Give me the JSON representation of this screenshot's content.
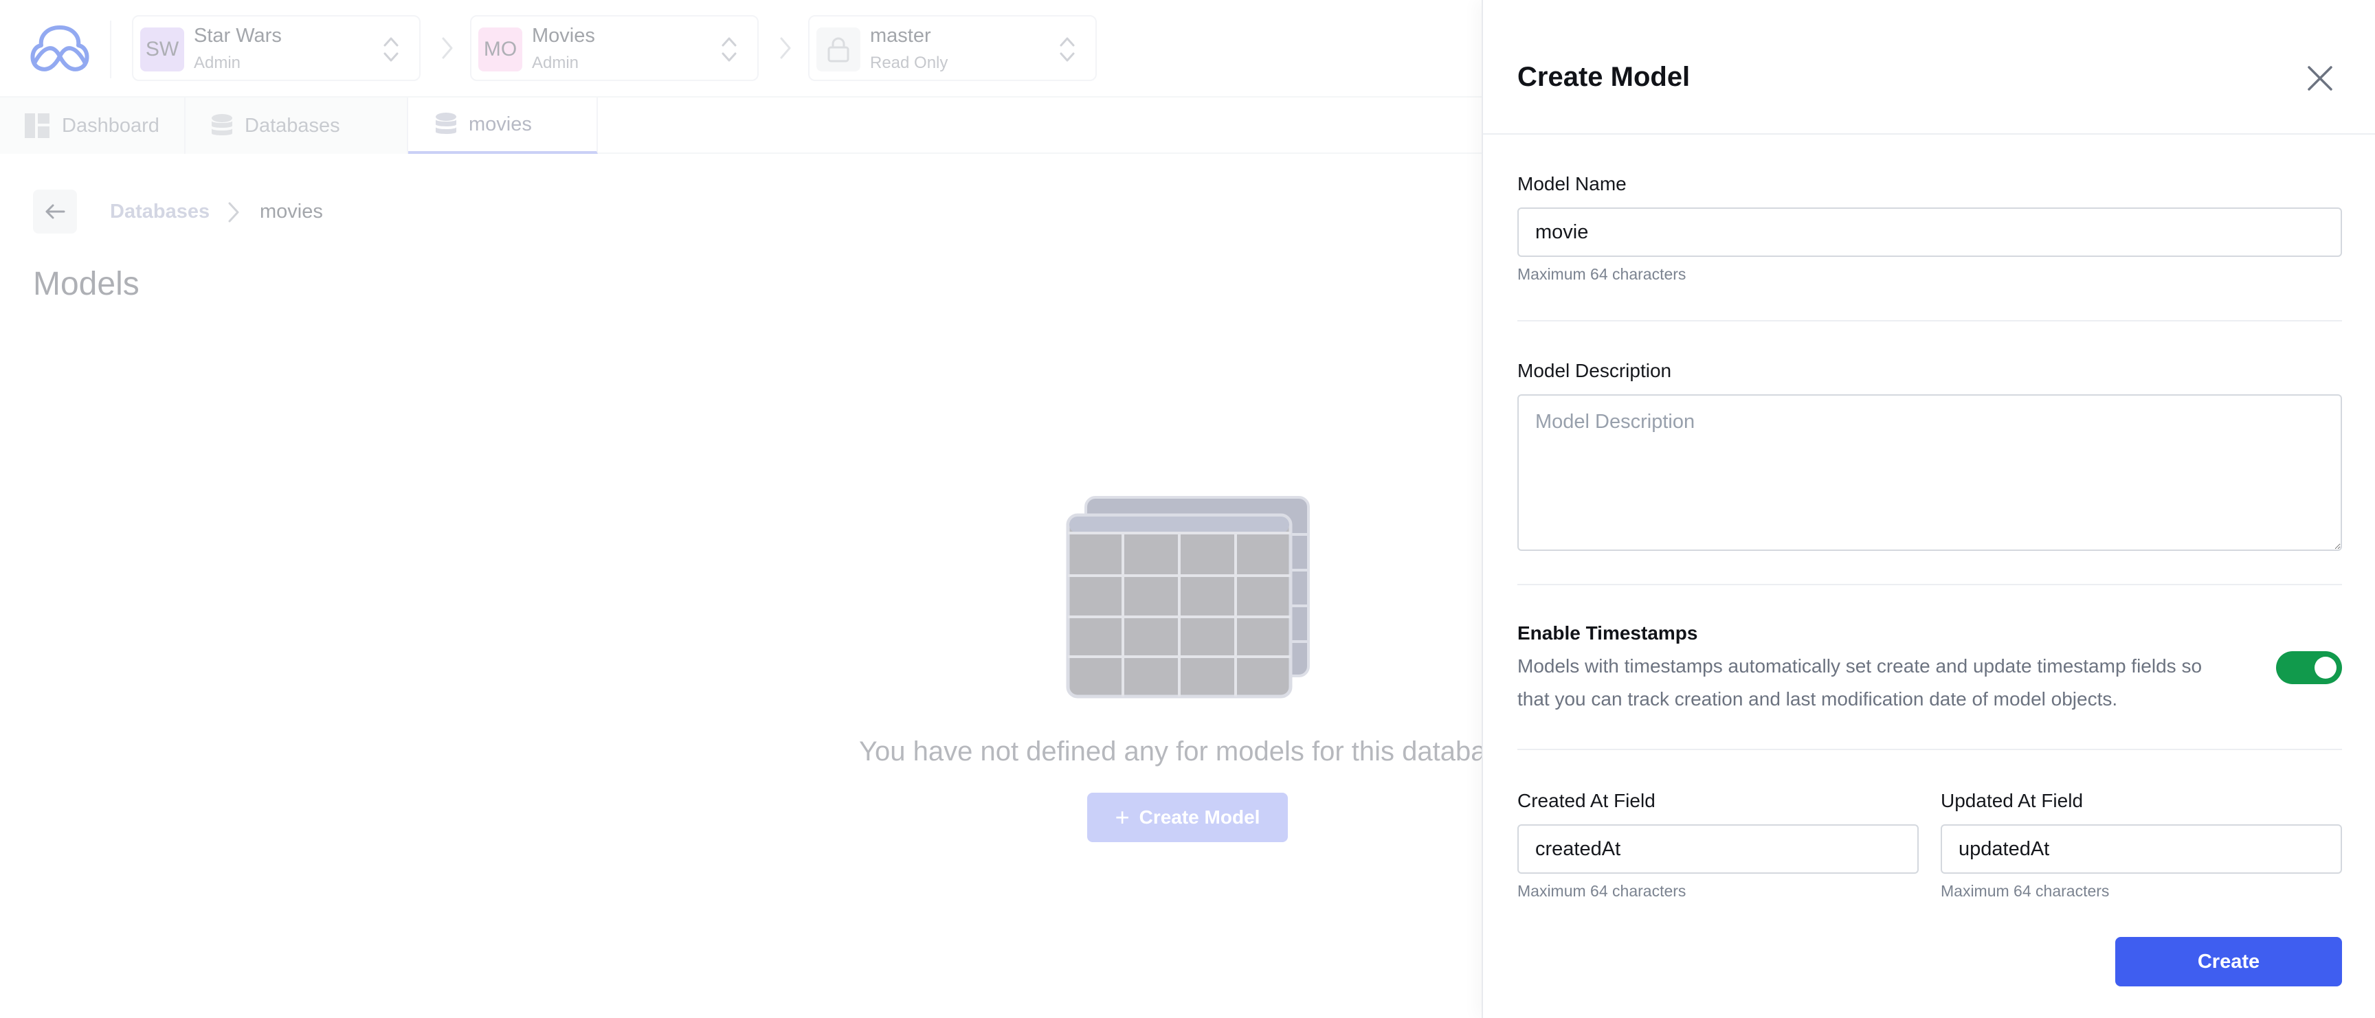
{
  "header": {
    "org": {
      "avatar": "SW",
      "name": "Star Wars",
      "role": "Admin",
      "avatar_color": "#ddd0f5"
    },
    "project": {
      "avatar": "MO",
      "name": "Movies",
      "role": "Admin",
      "avatar_color": "#fad7ef"
    },
    "branch": {
      "name": "master",
      "role": "Read Only",
      "icon": "lock-icon"
    }
  },
  "tabs": [
    {
      "label": "Dashboard",
      "icon": "dashboard-icon"
    },
    {
      "label": "Databases",
      "icon": "database-icon"
    },
    {
      "label": "movies",
      "icon": "database-icon",
      "active": true
    }
  ],
  "breadcrumb": {
    "parent": "Databases",
    "current": "movies"
  },
  "page": {
    "title": "Models",
    "empty_message": "You have not defined any for models for this database",
    "create_button": "Create Model"
  },
  "drawer": {
    "title": "Create Model",
    "model_name": {
      "label": "Model Name",
      "value": "movie",
      "hint": "Maximum 64 characters"
    },
    "model_description": {
      "label": "Model Description",
      "placeholder": "Model Description",
      "value": ""
    },
    "timestamps": {
      "label": "Enable Timestamps",
      "description": "Models with timestamps automatically set create and update timestamp fields so that you can track creation and last modification date of model objects.",
      "enabled": true
    },
    "created_at": {
      "label": "Created At Field",
      "value": "createdAt",
      "hint": "Maximum 64 characters"
    },
    "updated_at": {
      "label": "Updated At Field",
      "value": "updatedAt",
      "hint": "Maximum 64 characters"
    },
    "submit_label": "Create"
  },
  "colors": {
    "primary": "#3f5ef0",
    "toggle_on": "#119a4c",
    "primary_disabled": "#aab4f5"
  }
}
